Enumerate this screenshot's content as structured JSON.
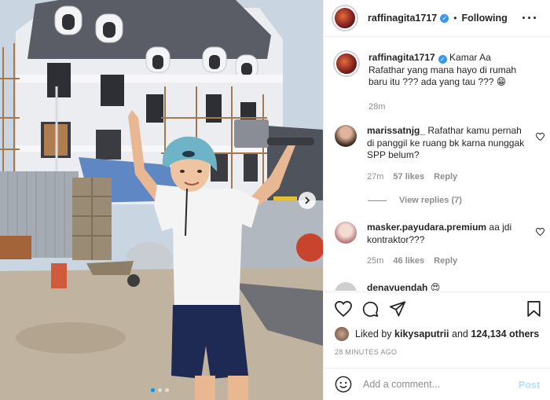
{
  "header": {
    "username": "raffinagita1717",
    "separator": "•",
    "follow_label": "Following",
    "more_icon": "more-horizontal-icon"
  },
  "caption": {
    "username": "raffinagita1717",
    "text": "Kamar Aa Rafathar yang mana hayo di rumah baru itu ??? ada yang tau ??? 😁",
    "time": "28m"
  },
  "comments": [
    {
      "username": "marissatnjg_",
      "text": "Rafathar kamu pernah di panggil ke ruang bk karna nunggak SPP belum?",
      "time": "27m",
      "likes": "57 likes",
      "reply_label": "Reply"
    },
    {
      "username": "masker.payudara.premium",
      "text": "aa jdi kontraktor???",
      "time": "25m",
      "likes": "46 likes",
      "reply_label": "Reply"
    },
    {
      "username": "denayuendah",
      "text": "😍"
    }
  ],
  "view_replies": "View replies (7)",
  "likes": {
    "prefix": "Liked by",
    "user": "kikysaputrii",
    "and": "and",
    "count": "124,134 others"
  },
  "timestamp": "28 MINUTES AGO",
  "add_comment": {
    "placeholder": "Add a comment...",
    "post_label": "Post"
  },
  "colors": {
    "verified": "#3897f0",
    "carousel_active": "#0095f6",
    "post_disabled": "#b2dffc",
    "meta_gray": "#8e8e8e"
  }
}
